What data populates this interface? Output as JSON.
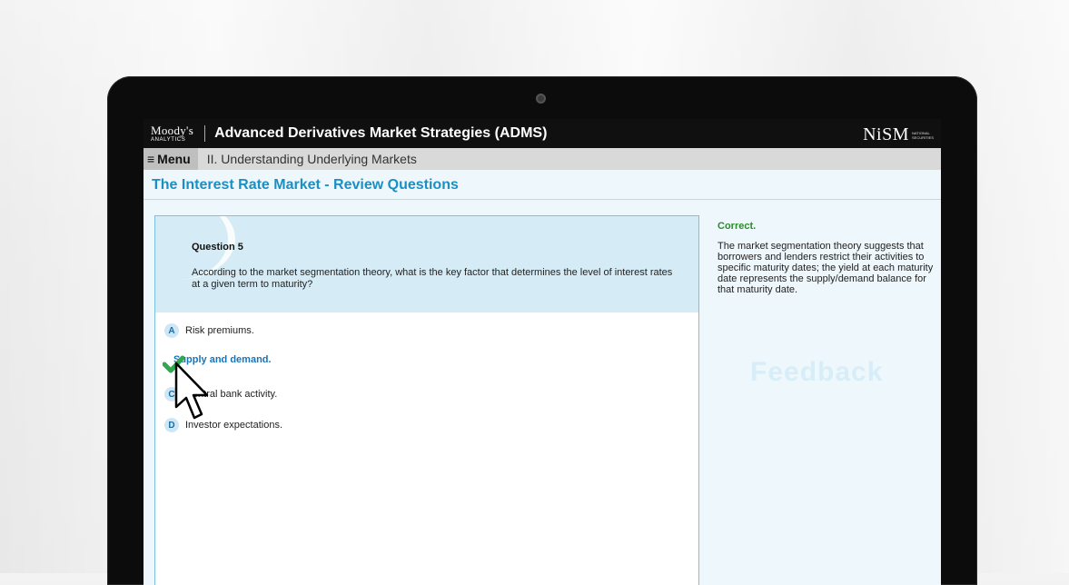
{
  "header": {
    "brand_line1": "Moody's",
    "brand_line2": "ANALYTICS",
    "course_title": "Advanced Derivatives Market Strategies (ADMS)",
    "partner_logo": "NiSM",
    "partner_tagline": "NATIONAL SECURITIES"
  },
  "menubar": {
    "menu_label": "Menu",
    "section": "II. Understanding Underlying Markets"
  },
  "page": {
    "title": "The Interest Rate Market - Review Questions"
  },
  "question": {
    "number_label": "Question 5",
    "text": "According to the market segmentation theory, what is the key factor that determines the level of interest rates at a given term to maturity?",
    "options": [
      {
        "letter": "A",
        "text": "Risk premiums."
      },
      {
        "letter": "B",
        "text": "Supply and demand."
      },
      {
        "letter": "C",
        "text": "Central bank activity."
      },
      {
        "letter": "D",
        "text": "Investor expectations."
      }
    ]
  },
  "feedback": {
    "status": "Correct.",
    "text": "The market segmentation theory suggests that borrowers and lenders restrict their activities to specific maturity dates; the yield at each maturity date represents the supply/demand balance for that maturity date.",
    "watermark": "Feedback"
  },
  "colors": {
    "accent": "#1a8fc4",
    "correct_green": "#2b8a2b",
    "check_green": "#2fa84f"
  },
  "icons": {
    "menu": "hamburger-icon",
    "check": "checkmark-icon",
    "cursor": "mouse-pointer-icon",
    "camera": "camera-icon"
  }
}
